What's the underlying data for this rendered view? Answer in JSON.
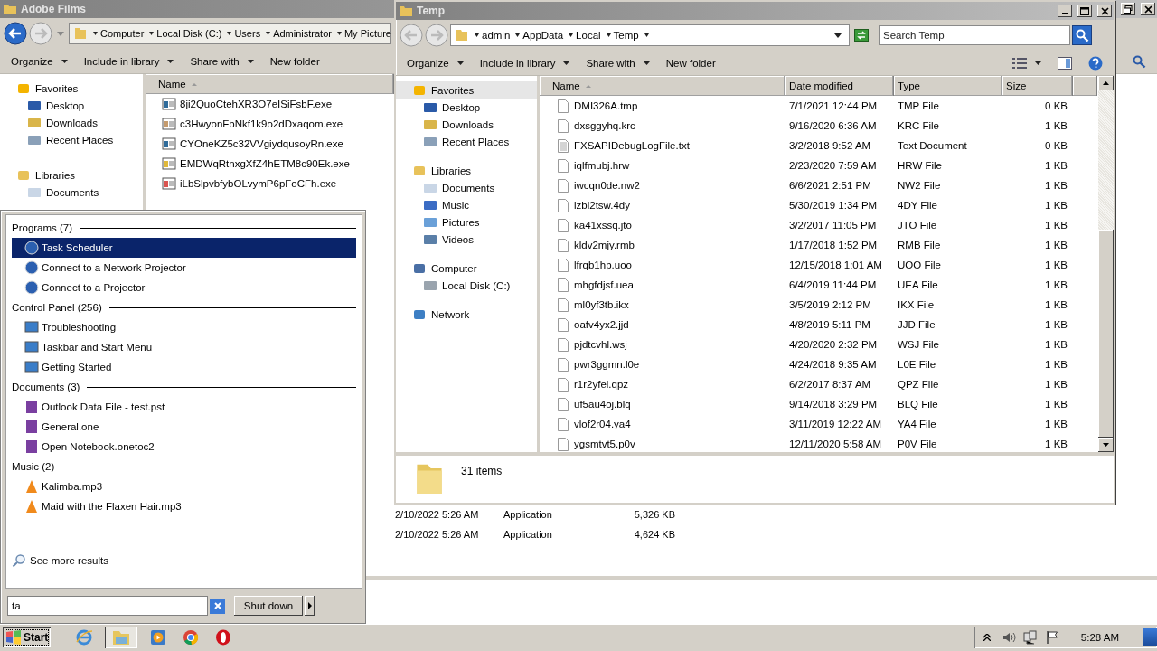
{
  "background_window": {
    "title": "Adobe Films",
    "breadcrumbs": [
      "Computer",
      "Local Disk (C:)",
      "Users",
      "Administrator",
      "My Picture"
    ],
    "toolbar": [
      "Organize",
      "Include in library",
      "Share with",
      "New folder"
    ],
    "nav": [
      {
        "label": "Favorites",
        "kind": "favorites",
        "children": [
          {
            "label": "Desktop",
            "kind": "desktop"
          },
          {
            "label": "Downloads",
            "kind": "downloads"
          },
          {
            "label": "Recent Places",
            "kind": "recent"
          }
        ]
      },
      {
        "label": "Libraries",
        "kind": "libraries",
        "children": [
          {
            "label": "Documents",
            "kind": "documents"
          }
        ]
      }
    ],
    "column_header": "Name",
    "files": [
      {
        "name": "8ji2QuoCtehXR3O7eISiFsbF.exe",
        "kind": "window"
      },
      {
        "name": "c3HwyonFbNkf1k9o2dDxaqom.exe",
        "kind": "package"
      },
      {
        "name": "CYOneKZ5c32VVgiydqusoyRn.exe",
        "kind": "window"
      },
      {
        "name": "EMDWqRtnxgXfZ4hETM8c90Ek.exe",
        "kind": "installer"
      },
      {
        "name": "iLbSlpvbfybOLvymP6pFoCFh.exe",
        "kind": "archive"
      }
    ],
    "partial_rows": [
      {
        "date": "2/10/2022 5:26 AM",
        "type": "Application",
        "size": "5,326 KB"
      },
      {
        "date": "2/10/2022 5:26 AM",
        "type": "Application",
        "size": "4,624 KB"
      }
    ]
  },
  "temp_window": {
    "title": "Temp",
    "breadcrumbs": [
      "admin",
      "AppData",
      "Local",
      "Temp"
    ],
    "search": {
      "placeholder": "Search Temp"
    },
    "toolbar": [
      "Organize",
      "Include in library",
      "Share with",
      "New folder"
    ],
    "nav": [
      {
        "label": "Favorites",
        "kind": "favorites",
        "selected": true,
        "children": [
          {
            "label": "Desktop",
            "kind": "desktop",
            "selected": false
          },
          {
            "label": "Downloads",
            "kind": "downloads",
            "selected": false
          },
          {
            "label": "Recent Places",
            "kind": "recent",
            "selected": false
          }
        ]
      },
      {
        "label": "Libraries",
        "kind": "libraries",
        "selected": false,
        "children": [
          {
            "label": "Documents",
            "kind": "documents",
            "selected": false
          },
          {
            "label": "Music",
            "kind": "music",
            "selected": false
          },
          {
            "label": "Pictures",
            "kind": "pictures",
            "selected": false
          },
          {
            "label": "Videos",
            "kind": "videos",
            "selected": false
          }
        ]
      },
      {
        "label": "Computer",
        "kind": "computer",
        "selected": false,
        "children": [
          {
            "label": "Local Disk (C:)",
            "kind": "drive",
            "selected": false
          }
        ]
      },
      {
        "label": "Network",
        "kind": "network",
        "selected": false
      }
    ],
    "columns": [
      "Name",
      "Date modified",
      "Type",
      "Size"
    ],
    "rows": [
      {
        "name": "DMI326A.tmp",
        "date": "7/1/2021 12:44 PM",
        "type": "TMP File",
        "size": "0 KB",
        "kind": "file"
      },
      {
        "name": "dxsggyhq.krc",
        "date": "9/16/2020 6:36 AM",
        "type": "KRC File",
        "size": "1 KB",
        "kind": "file"
      },
      {
        "name": "FXSAPIDebugLogFile.txt",
        "date": "3/2/2018 9:52 AM",
        "type": "Text Document",
        "size": "0 KB",
        "kind": "text"
      },
      {
        "name": "iqlfmubj.hrw",
        "date": "2/23/2020 7:59 AM",
        "type": "HRW File",
        "size": "1 KB",
        "kind": "file"
      },
      {
        "name": "iwcqn0de.nw2",
        "date": "6/6/2021 2:51 PM",
        "type": "NW2 File",
        "size": "1 KB",
        "kind": "file"
      },
      {
        "name": "izbi2tsw.4dy",
        "date": "5/30/2019 1:34 PM",
        "type": "4DY File",
        "size": "1 KB",
        "kind": "file"
      },
      {
        "name": "ka41xssq.jto",
        "date": "3/2/2017 11:05 PM",
        "type": "JTO File",
        "size": "1 KB",
        "kind": "file"
      },
      {
        "name": "kldv2mjy.rmb",
        "date": "1/17/2018 1:52 PM",
        "type": "RMB File",
        "size": "1 KB",
        "kind": "file"
      },
      {
        "name": "lfrqb1hp.uoo",
        "date": "12/15/2018 1:01 AM",
        "type": "UOO File",
        "size": "1 KB",
        "kind": "file"
      },
      {
        "name": "mhgfdjsf.uea",
        "date": "6/4/2019 11:44 PM",
        "type": "UEA File",
        "size": "1 KB",
        "kind": "file"
      },
      {
        "name": "ml0yf3tb.ikx",
        "date": "3/5/2019 2:12 PM",
        "type": "IKX File",
        "size": "1 KB",
        "kind": "file"
      },
      {
        "name": "oafv4yx2.jjd",
        "date": "4/8/2019 5:11 PM",
        "type": "JJD File",
        "size": "1 KB",
        "kind": "file"
      },
      {
        "name": "pjdtcvhl.wsj",
        "date": "4/20/2020 2:32 PM",
        "type": "WSJ File",
        "size": "1 KB",
        "kind": "file"
      },
      {
        "name": "pwr3ggmn.l0e",
        "date": "4/24/2018 9:35 AM",
        "type": "L0E File",
        "size": "1 KB",
        "kind": "file"
      },
      {
        "name": "r1r2yfei.qpz",
        "date": "6/2/2017 8:37 AM",
        "type": "QPZ File",
        "size": "1 KB",
        "kind": "file"
      },
      {
        "name": "uf5au4oj.blq",
        "date": "9/14/2018 3:29 PM",
        "type": "BLQ File",
        "size": "1 KB",
        "kind": "file"
      },
      {
        "name": "vlof2r04.ya4",
        "date": "3/11/2019 12:22 AM",
        "type": "YA4 File",
        "size": "1 KB",
        "kind": "file"
      },
      {
        "name": "ygsmtvt5.p0v",
        "date": "12/11/2020 5:58 AM",
        "type": "P0V File",
        "size": "1 KB",
        "kind": "file"
      }
    ],
    "item_count": "31 items"
  },
  "start_menu": {
    "sections": [
      {
        "heading": "Programs (7)",
        "kind": "programs",
        "items": [
          {
            "label": "Task Scheduler",
            "selected": true
          },
          {
            "label": "Connect to a Network Projector",
            "selected": false
          },
          {
            "label": "Connect to a Projector",
            "selected": false
          }
        ]
      },
      {
        "heading": "Control Panel (256)",
        "kind": "control_panel",
        "items": [
          {
            "label": "Troubleshooting",
            "selected": false
          },
          {
            "label": "Taskbar and Start Menu",
            "selected": false
          },
          {
            "label": "Getting Started",
            "selected": false
          }
        ]
      },
      {
        "heading": "Documents (3)",
        "kind": "documents",
        "items": [
          {
            "label": "Outlook Data File - test.pst",
            "selected": false
          },
          {
            "label": "General.one",
            "selected": false
          },
          {
            "label": "Open Notebook.onetoc2",
            "selected": false
          }
        ]
      },
      {
        "heading": "Music (2)",
        "kind": "music",
        "items": [
          {
            "label": "Kalimba.mp3",
            "selected": false
          },
          {
            "label": "Maid with the Flaxen Hair.mp3",
            "selected": false
          }
        ]
      }
    ],
    "see_more": "See more results",
    "search": {
      "value": "ta"
    },
    "shutdown": "Shut down"
  },
  "taskbar": {
    "start": "Start",
    "clock": "5:28 AM"
  }
}
